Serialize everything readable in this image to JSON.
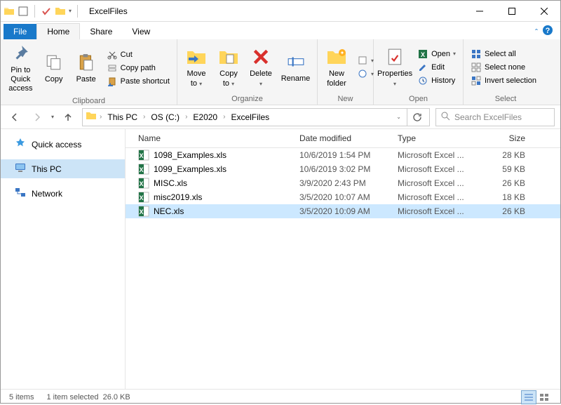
{
  "window": {
    "title": "ExcelFiles"
  },
  "tabs": {
    "file": "File",
    "home": "Home",
    "share": "Share",
    "view": "View"
  },
  "ribbon": {
    "clipboard": {
      "label": "Clipboard",
      "pin": "Pin to Quick\naccess",
      "copy": "Copy",
      "paste": "Paste",
      "cut": "Cut",
      "copypath": "Copy path",
      "pasteshortcut": "Paste shortcut"
    },
    "organize": {
      "label": "Organize",
      "moveto": "Move\nto",
      "copyto": "Copy\nto",
      "delete": "Delete",
      "rename": "Rename"
    },
    "new": {
      "label": "New",
      "newfolder": "New\nfolder"
    },
    "open": {
      "label": "Open",
      "properties": "Properties",
      "open": "Open",
      "edit": "Edit",
      "history": "History"
    },
    "select": {
      "label": "Select",
      "selectall": "Select all",
      "selectnone": "Select none",
      "invert": "Invert selection"
    }
  },
  "breadcrumbs": {
    "c0": "This PC",
    "c1": "OS (C:)",
    "c2": "E2020",
    "c3": "ExcelFiles"
  },
  "search": {
    "placeholder": "Search ExcelFiles"
  },
  "sidebar": {
    "quick": "Quick access",
    "thispc": "This PC",
    "network": "Network"
  },
  "columns": {
    "name": "Name",
    "date": "Date modified",
    "type": "Type",
    "size": "Size"
  },
  "files": [
    {
      "name": "1098_Examples.xls",
      "date": "10/6/2019 1:54 PM",
      "type": "Microsoft Excel ...",
      "size": "28 KB",
      "selected": false
    },
    {
      "name": "1099_Examples.xls",
      "date": "10/6/2019 3:02 PM",
      "type": "Microsoft Excel ...",
      "size": "59 KB",
      "selected": false
    },
    {
      "name": "MISC.xls",
      "date": "3/9/2020 2:43 PM",
      "type": "Microsoft Excel ...",
      "size": "26 KB",
      "selected": false
    },
    {
      "name": "misc2019.xls",
      "date": "3/5/2020 10:07 AM",
      "type": "Microsoft Excel ...",
      "size": "18 KB",
      "selected": false
    },
    {
      "name": "NEC.xls",
      "date": "3/5/2020 10:09 AM",
      "type": "Microsoft Excel ...",
      "size": "26 KB",
      "selected": true
    }
  ],
  "status": {
    "count": "5 items",
    "selected": "1 item selected",
    "size": "26.0 KB"
  }
}
